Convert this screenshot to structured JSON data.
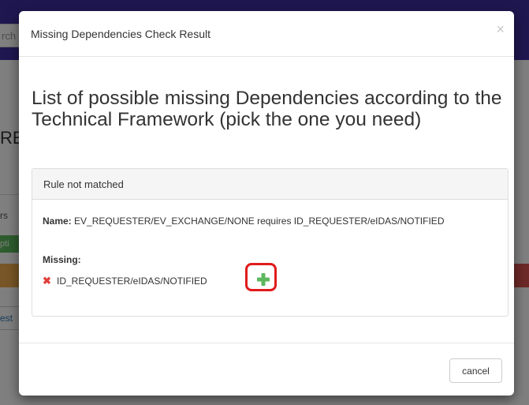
{
  "background": {
    "search_fragment": "rch",
    "heading_fragment": "RE",
    "text_fragment_1": "rs",
    "button_fragment": "pti",
    "link_fragment": "est"
  },
  "modal": {
    "title": "Missing Dependencies Check Result",
    "close_symbol": "×",
    "heading": "List of possible missing Dependencies according to the Technical Framework (pick the one you need)",
    "panel": {
      "heading": "Rule not matched",
      "name_label": "Name:",
      "name_value": "EV_REQUESTER/EV_EXCHANGE/NONE requires ID_REQUESTER/eIDAS/NOTIFIED",
      "missing_label": "Missing:",
      "missing_items": [
        {
          "icon": "x-icon",
          "text": "ID_REQUESTER/eIDAS/NOTIFIED",
          "action_icon": "plus-icon"
        }
      ]
    },
    "footer": {
      "cancel_label": "cancel"
    }
  },
  "colors": {
    "header_bar": "#3f2fa0",
    "remove_icon": "#e0403c",
    "add_icon": "#5cb85c",
    "highlight": "#e01b1b"
  }
}
